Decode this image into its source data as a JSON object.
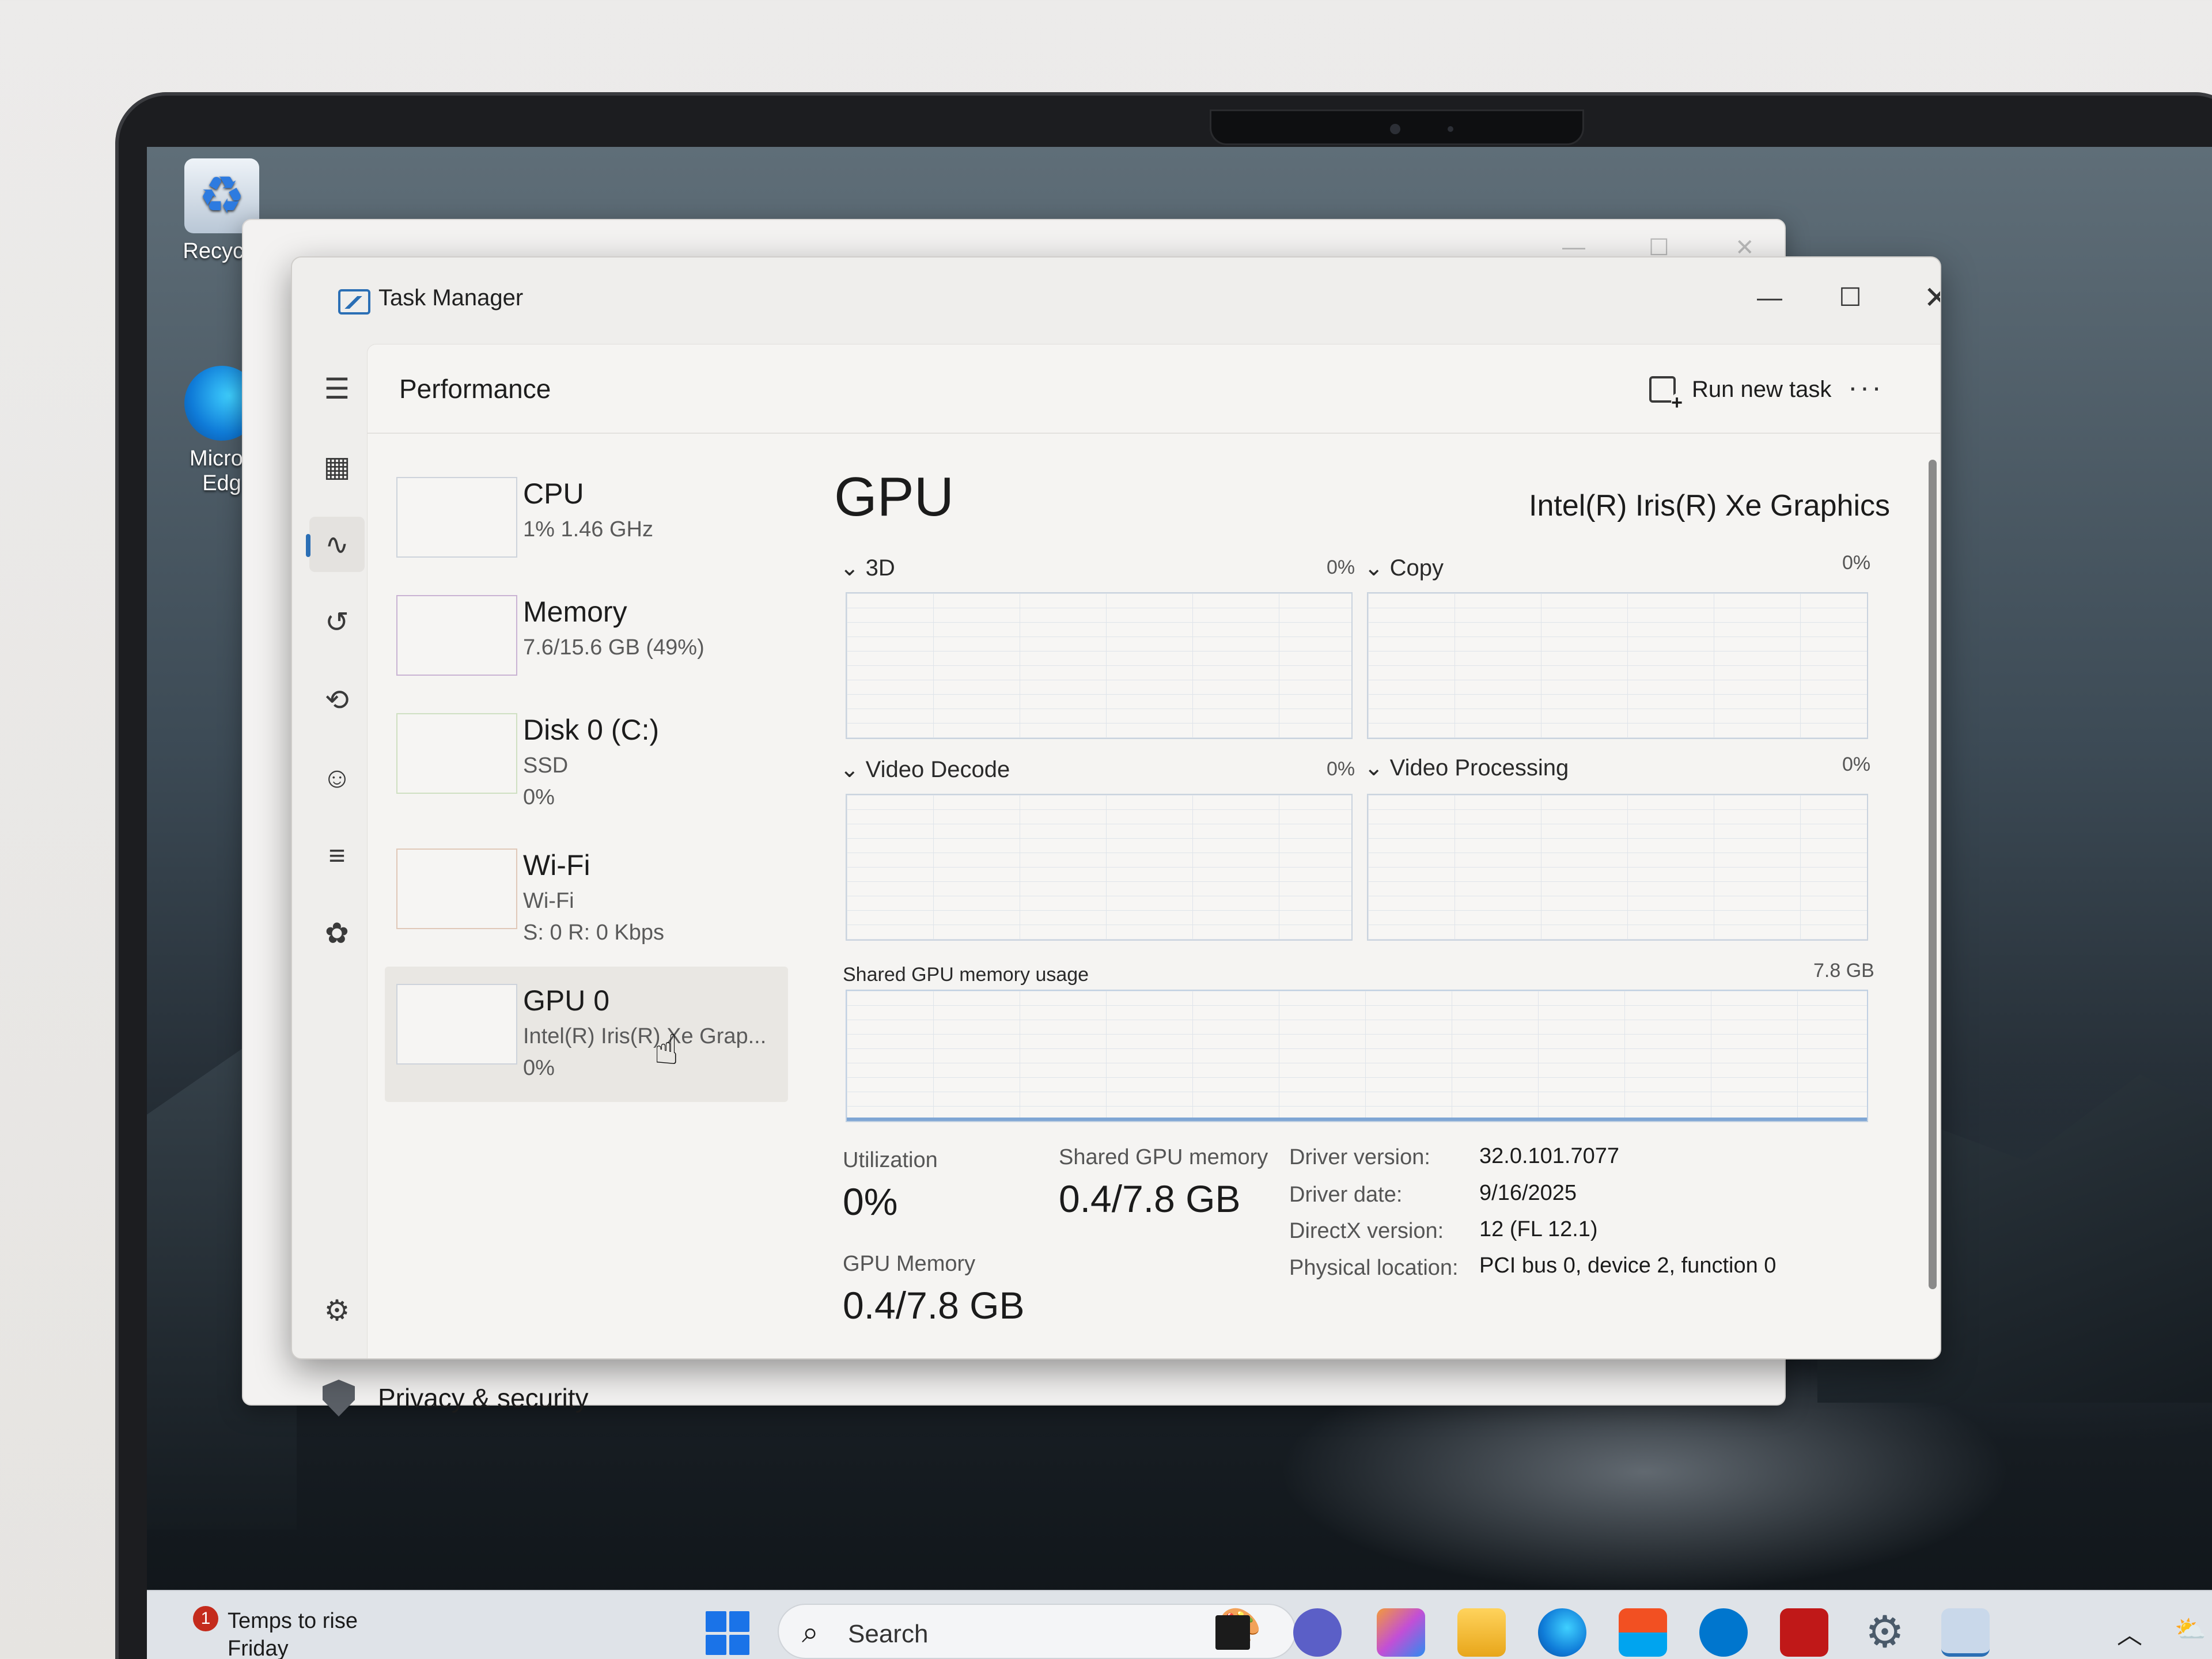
{
  "desktop": {
    "recycle_label": "Recycle",
    "edge_label_line1": "Micros",
    "edge_label_line2": "Edg"
  },
  "settings_window": {
    "privacy_label": "Privacy & security"
  },
  "task_manager": {
    "window_title": "Task Manager",
    "page_title": "Performance",
    "run_new_task": "Run new task",
    "more_options": "···",
    "devices": [
      {
        "name": "CPU",
        "sub1": "1%  1.46 GHz",
        "sub2": ""
      },
      {
        "name": "Memory",
        "sub1": "7.6/15.6 GB (49%)",
        "sub2": ""
      },
      {
        "name": "Disk 0 (C:)",
        "sub1": "SSD",
        "sub2": "0%"
      },
      {
        "name": "Wi-Fi",
        "sub1": "Wi-Fi",
        "sub2": "S: 0  R: 0 Kbps"
      },
      {
        "name": "GPU 0",
        "sub1": "Intel(R) Iris(R) Xe Grap...",
        "sub2": "0%"
      }
    ],
    "gpu": {
      "title": "GPU",
      "model": "Intel(R) Iris(R) Xe Graphics",
      "engines": [
        {
          "label": "3D",
          "pct": "0%"
        },
        {
          "label": "Copy",
          "pct": "0%"
        },
        {
          "label": "Video Decode",
          "pct": "0%"
        },
        {
          "label": "Video Processing",
          "pct": "0%"
        }
      ],
      "shared_mem_label": "Shared GPU memory usage",
      "shared_mem_max": "7.8 GB",
      "stats": {
        "utilization_label": "Utilization",
        "utilization_value": "0%",
        "shared_label": "Shared GPU memory",
        "shared_value": "0.4/7.8 GB",
        "gpu_mem_label": "GPU Memory",
        "gpu_mem_value": "0.4/7.8 GB"
      },
      "properties": [
        {
          "key": "Driver version:",
          "value": "32.0.101.7077"
        },
        {
          "key": "Driver date:",
          "value": "9/16/2025"
        },
        {
          "key": "DirectX version:",
          "value": "12 (FL 12.1)"
        },
        {
          "key": "Physical location:",
          "value": "PCI bus 0, device 2, function 0"
        }
      ]
    }
  },
  "taskbar": {
    "weather_title": "Temps to rise",
    "weather_sub": "Friday",
    "weather_badge": "1",
    "search_placeholder": "Search"
  },
  "colors": {
    "accent": "#2b6fb5",
    "graph_border": "#c9d3de",
    "start_blue": "#1a73e8"
  }
}
